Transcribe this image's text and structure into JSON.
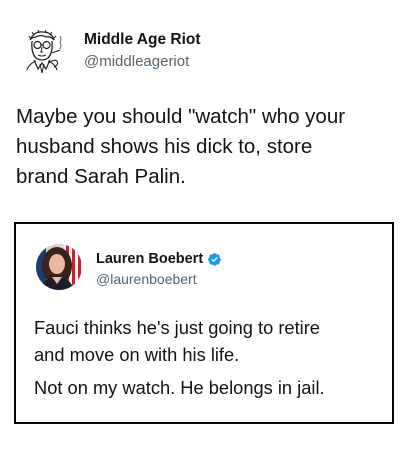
{
  "tweet": {
    "author": {
      "name": "Middle Age Riot",
      "handle": "@middleageriot",
      "avatar_icon": "sketched-man-avatar-icon"
    },
    "text": "Maybe you should \"watch\" who your\nhusband shows his dick to, store\nbrand Sarah Palin."
  },
  "quoted_tweet": {
    "author": {
      "name": "Lauren Boebert",
      "handle": "@laurenboebert",
      "verified": true,
      "verified_icon": "verified-badge-icon",
      "avatar_icon": "profile-photo-avatar-icon"
    },
    "text_paragraph_1": "Fauci thinks he's just going to retire\nand move on with his life.",
    "text_paragraph_2": "Not on my watch. He belongs in jail."
  },
  "colors": {
    "text_primary": "#0f1419",
    "text_secondary": "#536471",
    "verified_blue": "#1d9bf0",
    "quote_border": "#000000",
    "background": "#ffffff"
  }
}
